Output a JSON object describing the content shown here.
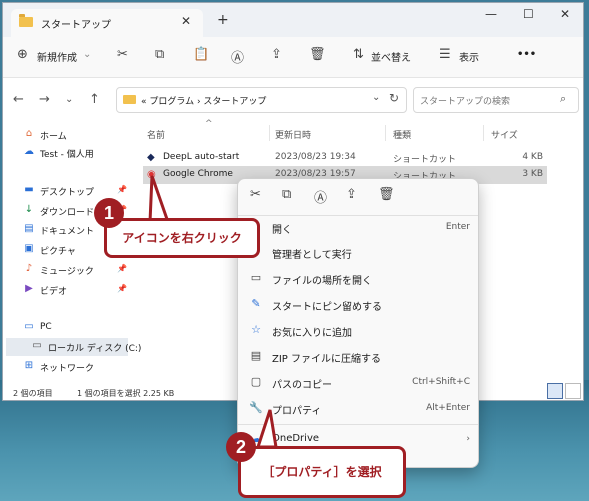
{
  "window": {
    "tab_title": "スタートアップ",
    "tab_close": "✕",
    "new_tab": "+",
    "min": "—",
    "max": "☐",
    "close": "✕"
  },
  "toolbar": {
    "new_label": "新規作成",
    "sort_label": "並べ替え",
    "view_label": "表示",
    "more": "•••"
  },
  "address": {
    "path": "« プログラム › スタートアップ",
    "search_placeholder": "スタートアップの検索"
  },
  "sidebar": {
    "items": [
      {
        "label": "ホーム",
        "icon": "home-icon"
      },
      {
        "label": "Test - 個人用",
        "icon": "cloud-icon"
      },
      {
        "label": "デスクトップ",
        "icon": "desktop-icon"
      },
      {
        "label": "ダウンロード",
        "icon": "download-icon"
      },
      {
        "label": "ドキュメント",
        "icon": "document-icon"
      },
      {
        "label": "ピクチャ",
        "icon": "picture-icon"
      },
      {
        "label": "ミュージック",
        "icon": "music-icon"
      },
      {
        "label": "ビデオ",
        "icon": "video-icon"
      },
      {
        "label": "PC",
        "icon": "pc-icon"
      },
      {
        "label": "ローカル ディスク (C:)",
        "icon": "disk-icon"
      },
      {
        "label": "ネットワーク",
        "icon": "network-icon"
      }
    ]
  },
  "columns": {
    "name": "名前",
    "date": "更新日時",
    "type": "種類",
    "size": "サイズ"
  },
  "files": [
    {
      "name": "DeepL auto-start",
      "date": "2023/08/23 19:34",
      "type": "ショートカット",
      "size": "4 KB"
    },
    {
      "name": "Google Chrome",
      "date": "2023/08/23 19:57",
      "type": "ショートカット",
      "size": "3 KB"
    }
  ],
  "status": {
    "count": "2 個の項目",
    "selected": "1 個の項目を選択  2.25 KB"
  },
  "context_menu": {
    "items": [
      {
        "label": "開く",
        "key": "Enter"
      },
      {
        "label": "管理者として実行",
        "key": ""
      },
      {
        "label": "ファイルの場所を開く",
        "key": ""
      },
      {
        "label": "スタートにピン留めする",
        "key": ""
      },
      {
        "label": "お気に入りに追加",
        "key": ""
      },
      {
        "label": "ZIP ファイルに圧縮する",
        "key": ""
      },
      {
        "label": "パスのコピー",
        "key": "Ctrl+Shift+C"
      },
      {
        "label": "プロパティ",
        "key": "Alt+Enter"
      },
      {
        "label": "OneDrive",
        "key": "›"
      }
    ]
  },
  "annotations": {
    "step1_number": "1",
    "step1_text": "アイコンを右クリック",
    "step2_number": "2",
    "step2_text": "［プロパティ］を選択"
  },
  "colors": {
    "callout": "#a01e23",
    "selection": "#d9d9d9"
  }
}
